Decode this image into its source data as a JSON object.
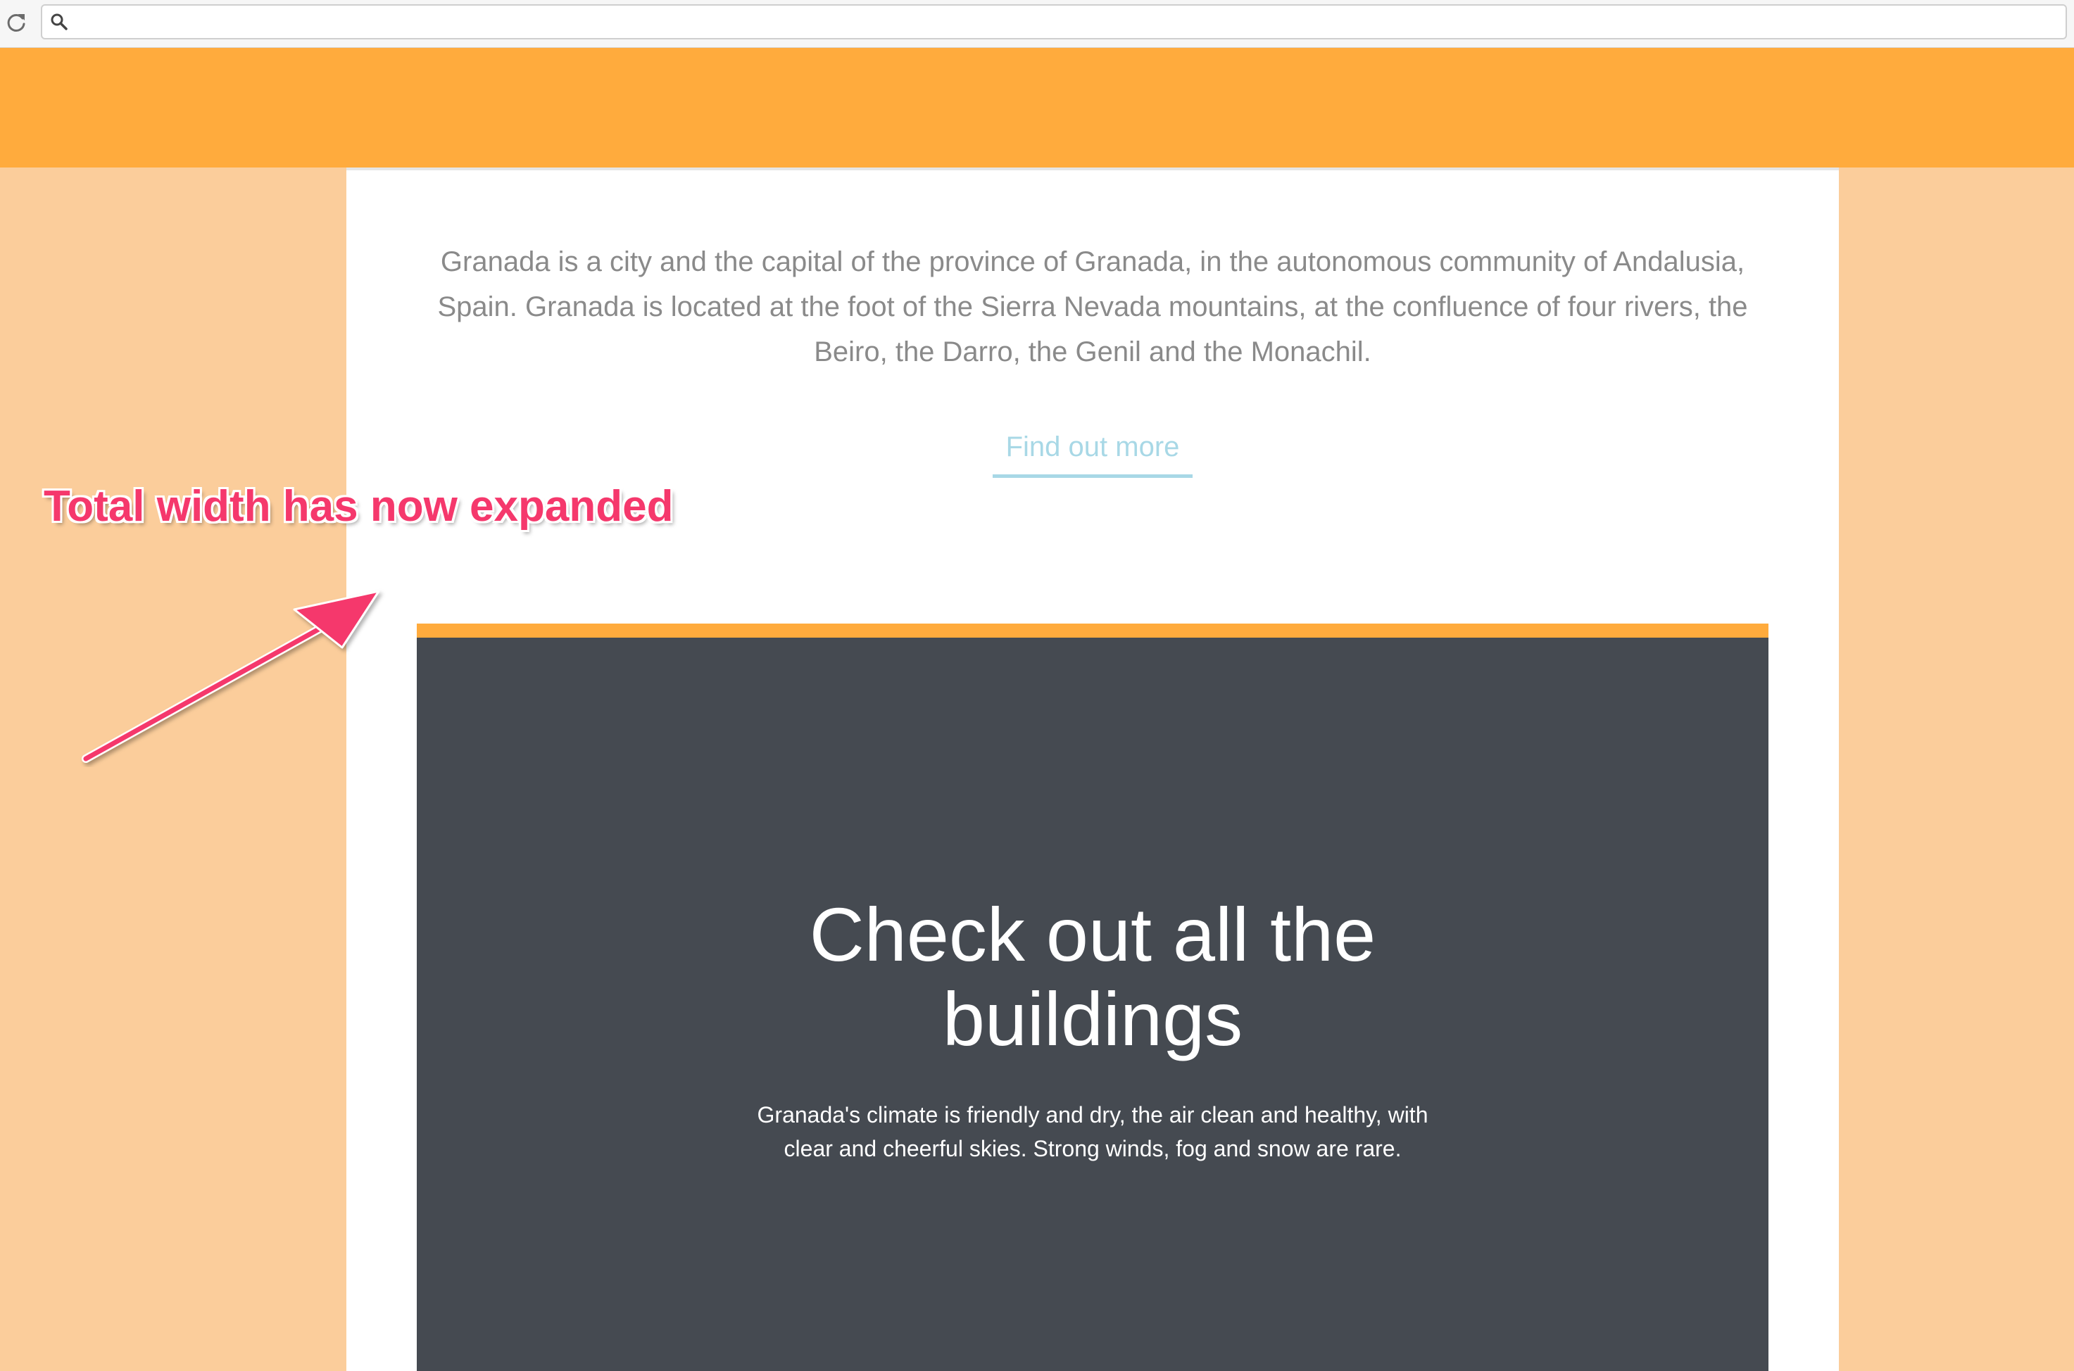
{
  "browser": {
    "icons": {
      "reload": "reload-icon",
      "search": "search-icon"
    },
    "address": {
      "value": "",
      "placeholder": ""
    }
  },
  "colors": {
    "header": "#ffab3d",
    "side_background": "#fbcd9b",
    "content_background": "#ffffff",
    "panel_background": "#454a51",
    "link": "#a8d8e6",
    "annotation": "#f5386c"
  },
  "intro": {
    "lines": [
      "Granada is a city and the capital of the province of Granada, in the autonomous community of Andalusia,",
      "Spain. Granada is located at the foot of the Sierra Nevada mountains, at the confluence of four rivers, the",
      "Beiro, the Darro, the Genil and the Monachil."
    ],
    "link_label": "Find out more"
  },
  "feature": {
    "title_lines": [
      "Check out all the",
      "buildings"
    ],
    "text_lines": [
      "Granada's climate is friendly and dry, the air clean and healthy, with",
      "clear and cheerful skies. Strong winds, fog and snow are rare."
    ]
  },
  "annotation": {
    "label": "Total width has now expanded",
    "icon": "arrow-icon"
  }
}
